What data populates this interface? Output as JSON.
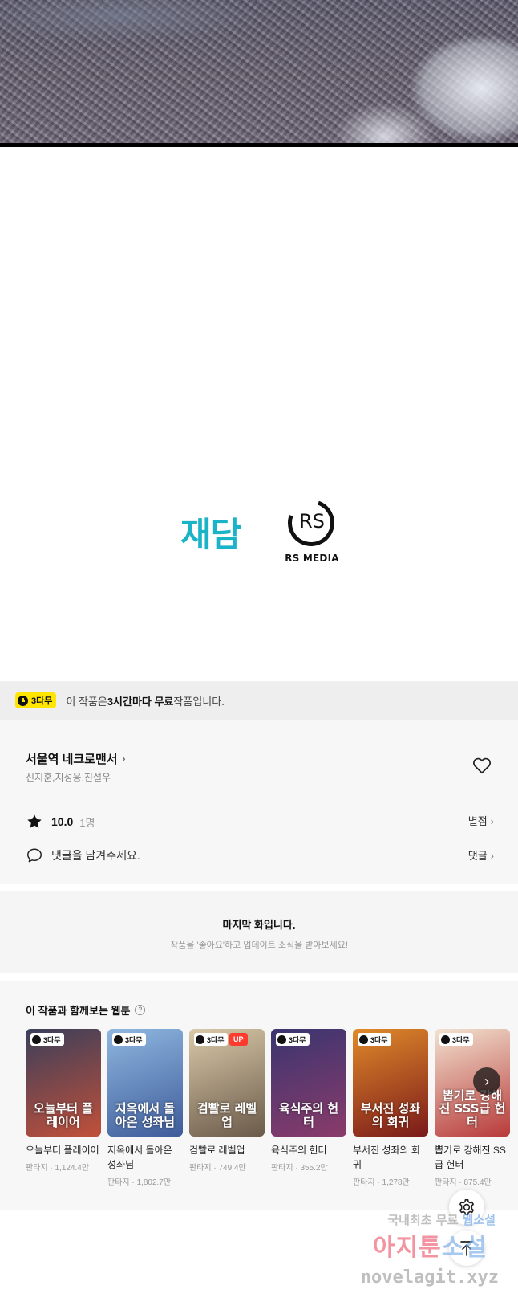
{
  "notice": {
    "badge": "3다무",
    "text_before": "이 작품은 ",
    "text_bold": "3시간마다 무료",
    "text_after": " 작품입니다."
  },
  "logos": {
    "publisher_1": "재담",
    "publisher_2_letters": "RS",
    "publisher_2_caption": "RS MEDIA"
  },
  "series": {
    "title": "서울역 네크로맨서",
    "authors": "신지훈,지성웅,진설우",
    "rating_score": "10.0",
    "rating_count": "1명",
    "rate_link": "별점",
    "comment_prompt": "댓글을 남겨주세요.",
    "comment_link": "댓글"
  },
  "last_episode": {
    "title": "마지막 화입니다.",
    "subtitle": "작품을 '좋아요'하고 업데이트 소식을 받아보세요!"
  },
  "recommendations": {
    "heading": "이 작품과 함께보는 웹툰",
    "items": [
      {
        "badge": "3다무",
        "up": "",
        "cover_text": "오늘부터 플레이어",
        "title": "오늘부터 플레이어",
        "meta": "판타지 · 1,124.4만",
        "color_top": "#3a3f5a",
        "color_bottom": "#c1503a"
      },
      {
        "badge": "3다무",
        "up": "",
        "cover_text": "지옥에서 돌아온 성좌님",
        "title": "지옥에서 돌아온 성좌님",
        "meta": "판타지 · 1,802.7만",
        "color_top": "#8fb7e0",
        "color_bottom": "#3e5c9a"
      },
      {
        "badge": "3다무",
        "up": "UP",
        "cover_text": "검빨로 레벨업",
        "title": "검빨로 레벨업",
        "meta": "판타지 · 749.4만",
        "color_top": "#d9c9a8",
        "color_bottom": "#6b5a4a"
      },
      {
        "badge": "3다무",
        "up": "",
        "cover_text": "육식주의 헌터",
        "title": "육식주의 헌터",
        "meta": "판타지 · 355.2만",
        "color_top": "#3a3570",
        "color_bottom": "#8a3b6a"
      },
      {
        "badge": "3다무",
        "up": "",
        "cover_text": "부서진 성좌의 회귀",
        "title": "부서진 성좌의 회귀",
        "meta": "판타지 · 1,278만",
        "color_top": "#e08a2a",
        "color_bottom": "#7a1a1a"
      },
      {
        "badge": "3다무",
        "up": "",
        "cover_text": "뽑기로 강해진 SSS급 헌터",
        "title": "뽑기로 강해진 SS급 헌터",
        "meta": "판타지 · 875.4만",
        "color_top": "#f2e3d0",
        "color_bottom": "#b83a3a"
      }
    ]
  },
  "watermark": {
    "line1_a": "국내최초 무료 ",
    "line1_b": "웹소설",
    "line2_a": "아지툰",
    "line2_b": "소설",
    "line3": "novelagit.xyz"
  },
  "icons": {
    "heart": "heart-icon",
    "star": "star-icon",
    "comment": "comment-bubble-icon",
    "next": "chevron-right-icon",
    "settings": "gear-icon",
    "top": "arrow-up-icon"
  },
  "colors": {
    "badge_yellow": "#ffe500",
    "up_red": "#ff3b30",
    "jaedam_teal": "#1ab3c8"
  }
}
